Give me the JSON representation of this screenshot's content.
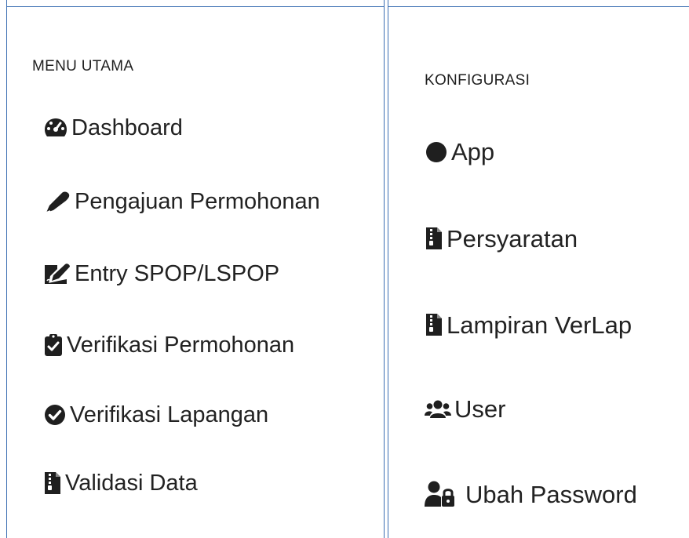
{
  "left_panel": {
    "title": "MENU UTAMA",
    "items": [
      {
        "label": "Dashboard",
        "icon": "tachometer-icon"
      },
      {
        "label": "Pengajuan Permohonan",
        "icon": "pen-icon"
      },
      {
        "label": "Entry SPOP/LSPOP",
        "icon": "signature-icon"
      },
      {
        "label": "Verifikasi Permohonan",
        "icon": "clipboard-check-icon"
      },
      {
        "label": "Verifikasi Lapangan",
        "icon": "check-circle-icon"
      },
      {
        "label": "Validasi Data",
        "icon": "file-archive-icon"
      }
    ]
  },
  "right_panel": {
    "title": "KONFIGURASI",
    "items": [
      {
        "label": "App",
        "icon": "circle-icon"
      },
      {
        "label": "Persyaratan",
        "icon": "file-archive-icon"
      },
      {
        "label": "Lampiran VerLap",
        "icon": "file-archive-icon"
      },
      {
        "label": "User",
        "icon": "users-icon"
      },
      {
        "label": "Ubah Password",
        "icon": "user-lock-icon"
      }
    ]
  },
  "colors": {
    "border": "#3b6fb3",
    "text": "#222222",
    "background": "#ffffff"
  }
}
